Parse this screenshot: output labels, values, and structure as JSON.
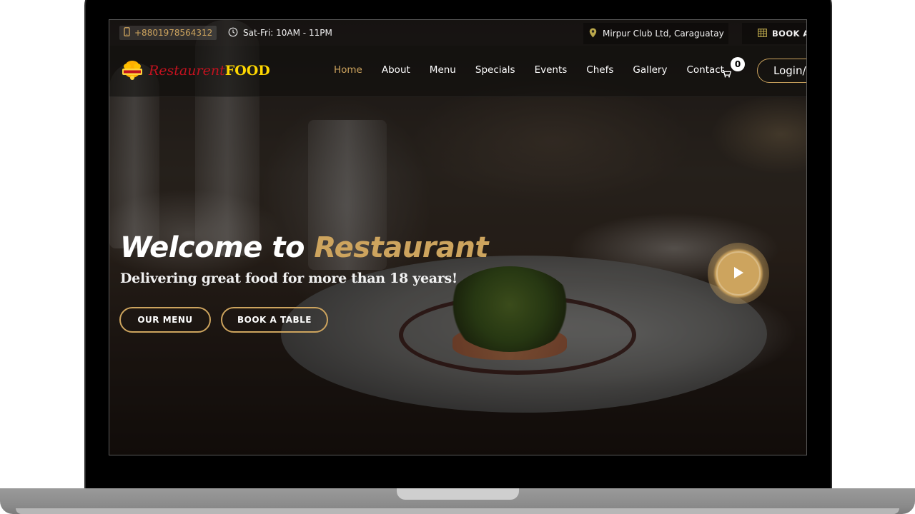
{
  "topbar": {
    "phone": "+8801978564312",
    "hours": "Sat-Fri: 10AM - 11PM",
    "location": "Mirpur Club Ltd, Caraguatay",
    "book_link": "BOOK A TABLE"
  },
  "nav": {
    "logo_part1": "Restaurent",
    "logo_part2": "FOOD",
    "links": [
      "Home",
      "About",
      "Menu",
      "Specials",
      "Events",
      "Chefs",
      "Gallery",
      "Contact"
    ],
    "active": "Home",
    "cart_count": "0",
    "login_label": "Login/Signup"
  },
  "hero": {
    "title_prefix": "Welcome to ",
    "title_accent": "Restaurant",
    "subtitle": "Delivering great food for more than 18 years!",
    "btn_menu": "OUR MENU",
    "btn_table": "BOOK A TABLE"
  },
  "colors": {
    "accent": "#cda45e",
    "logo_red": "#c1121f",
    "logo_yellow": "#ffd700"
  },
  "icons": [
    "mobile-phone-icon",
    "clock-icon",
    "map-pin-icon",
    "calendar-icon",
    "cart-icon",
    "play-icon",
    "chef-logo-icon"
  ]
}
